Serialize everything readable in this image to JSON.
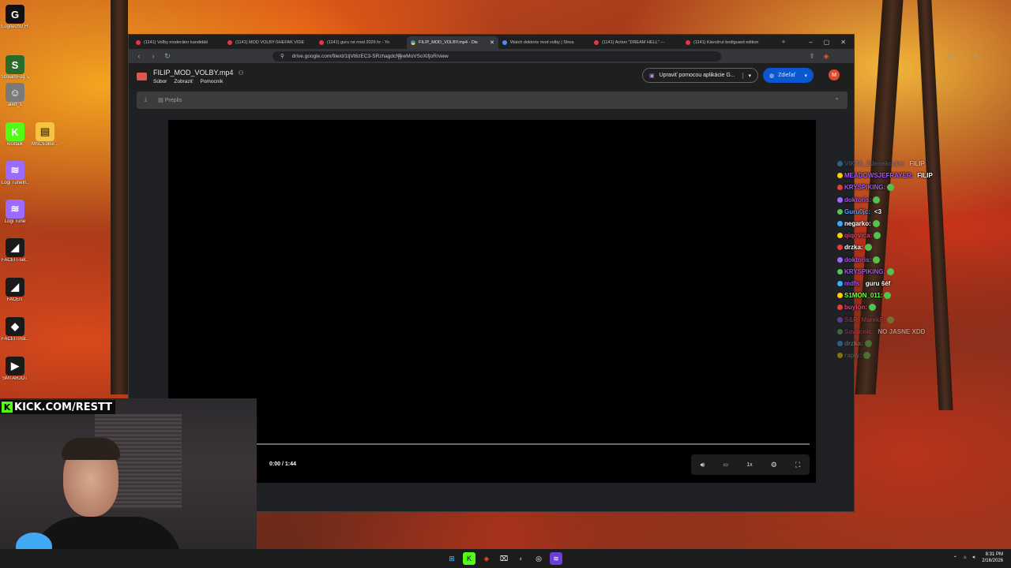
{
  "desktop": {
    "icons": [
      {
        "label": "LogitechG HUB",
        "color": "#111111",
        "glyph": "G"
      },
      {
        "label": "StreamFog VirtualCam",
        "color": "#2a6b2a",
        "glyph": "S"
      },
      {
        "label": "alert_1",
        "color": "#7a7a7a",
        "glyph": "☺"
      },
      {
        "label": "kicktalk",
        "color": "#53fc18",
        "glyph": "K"
      },
      {
        "label": "Logi TuneIn...",
        "color": "#9b6bff",
        "glyph": "≋"
      },
      {
        "label": "Logi Tune",
        "color": "#9b6bff",
        "glyph": "≋"
      },
      {
        "label": "FACEIT-set...",
        "color": "#1a1a1a",
        "glyph": "◢"
      },
      {
        "label": "FACEIT",
        "color": "#1a1a1a",
        "glyph": "◢"
      },
      {
        "label": "FACEITInst...",
        "color": "#1a1a1a",
        "glyph": "◆"
      },
      {
        "label": "SMTARJOT",
        "color": "#1a1a1a",
        "glyph": "▶"
      }
    ],
    "icon2": {
      "label": "MSCEditor...",
      "color": "#f5c542",
      "glyph": "▤"
    }
  },
  "browser": {
    "tabs": [
      {
        "label": "(1141) Voľby moderátor kandidáti",
        "favicon": "youtube",
        "active": false
      },
      {
        "label": "(1141) MOD VOLBY-SHEFAK VIDE",
        "favicon": "youtube",
        "active": false
      },
      {
        "label": "(1141) guru rst mod 2026 hr - Yo",
        "favicon": "youtube",
        "active": false
      },
      {
        "label": "FILIP_MOD_VOLBY.mp4 - Dis",
        "favicon": "drive",
        "active": true
      },
      {
        "label": "Watch doktoris mod volby | Strea",
        "favicon": "streamable",
        "active": false
      },
      {
        "label": "(1141) Action \"DREAM HELL\" ---",
        "favicon": "youtube",
        "active": false
      },
      {
        "label": "(1141) Kávožrut bodiguard edition",
        "favicon": "youtube",
        "active": false
      }
    ],
    "url": "drive.google.com/file/d/1tjVt6zEC3-SRzhagdcNewMoVSoXifjoR/view"
  },
  "drive": {
    "file_name": "FILIP_MOD_VOLBY.mp4",
    "menu": [
      "Súbor",
      "Zobraziť",
      "Pomocník"
    ],
    "open_with": "Upraviť pomocou aplikácie G...",
    "share": "Zdieľať",
    "avatar": "M",
    "preview_label": "Preplis"
  },
  "player": {
    "time": "0:00 / 1:44",
    "speed": "1x",
    "progress": 0.0
  },
  "chat": [
    {
      "user": "VIKTA_Zdenekcube:",
      "msg": "FILIP",
      "color": "#5a7bd6",
      "faded": true
    },
    {
      "user": "MEADOWSJEFRAYER:",
      "msg": "FILIP",
      "color": "#a855f7",
      "faded": false
    },
    {
      "user": "KRYSPIKING:",
      "msg": "",
      "color": "#a855f7",
      "faded": false
    },
    {
      "user": "doktoris:",
      "msg": "",
      "color": "#a855f7",
      "faded": false
    },
    {
      "user": "Guru0jc:",
      "msg": "<3",
      "color": "#5aa0ff",
      "faded": false
    },
    {
      "user": "negarko:",
      "msg": "",
      "color": "#ffffff",
      "faded": false
    },
    {
      "user": "qiqovica:",
      "msg": "",
      "color": "#e0467a",
      "faded": false
    },
    {
      "user": "drzka:",
      "msg": "",
      "color": "#ffffff",
      "faded": false
    },
    {
      "user": "doktoris:",
      "msg": "",
      "color": "#a855f7",
      "faded": false
    },
    {
      "user": "KRYSPIKING:",
      "msg": "",
      "color": "#a855f7",
      "faded": false
    },
    {
      "user": "mdfs:",
      "msg": "guru šéf",
      "color": "#a855f7",
      "faded": false
    },
    {
      "user": "S1MON_011:",
      "msg": "",
      "color": "#6dff4a",
      "faded": false
    },
    {
      "user": "buylon:",
      "msg": "",
      "color": "#e0467a",
      "faded": false
    },
    {
      "user": "S&R_MarekF:",
      "msg": "",
      "color": "#e0467a",
      "faded": true
    },
    {
      "user": "Savacnic:",
      "msg": "NO JASNE XDD",
      "color": "#e0467a",
      "faded": true
    },
    {
      "user": "drzka:",
      "msg": "",
      "color": "#aaaaaa",
      "faded": true
    },
    {
      "user": "raply:",
      "msg": "",
      "color": "#888888",
      "faded": true
    }
  ],
  "stream": {
    "kick_url": "KICK.COM/RESTT"
  },
  "taskbar": {
    "time": "8:31 PM",
    "date": "2/16/2026"
  }
}
